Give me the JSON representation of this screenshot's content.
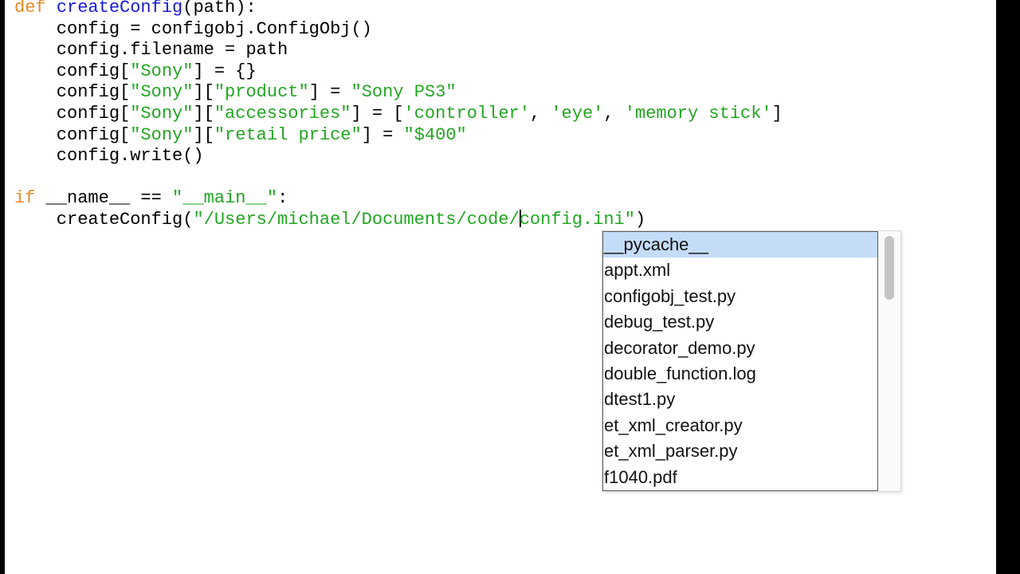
{
  "editor": {
    "lines": [
      [
        {
          "t": "def",
          "c": "kw"
        },
        {
          "t": " "
        },
        {
          "t": "createConfig",
          "c": "fn"
        },
        {
          "t": "(path):"
        }
      ],
      [
        {
          "t": "    config = configobj.ConfigObj()"
        }
      ],
      [
        {
          "t": "    config.filename = path"
        }
      ],
      [
        {
          "t": "    config["
        },
        {
          "t": "\"Sony\"",
          "c": "str"
        },
        {
          "t": "] = {}"
        }
      ],
      [
        {
          "t": "    config["
        },
        {
          "t": "\"Sony\"",
          "c": "str"
        },
        {
          "t": "]["
        },
        {
          "t": "\"product\"",
          "c": "str"
        },
        {
          "t": "] = "
        },
        {
          "t": "\"Sony PS3\"",
          "c": "str"
        }
      ],
      [
        {
          "t": "    config["
        },
        {
          "t": "\"Sony\"",
          "c": "str"
        },
        {
          "t": "]["
        },
        {
          "t": "\"accessories\"",
          "c": "str"
        },
        {
          "t": "] = ["
        },
        {
          "t": "'controller'",
          "c": "str"
        },
        {
          "t": ", "
        },
        {
          "t": "'eye'",
          "c": "str"
        },
        {
          "t": ", "
        },
        {
          "t": "'memory stick'",
          "c": "str"
        },
        {
          "t": "]"
        }
      ],
      [
        {
          "t": "    config["
        },
        {
          "t": "\"Sony\"",
          "c": "str"
        },
        {
          "t": "]["
        },
        {
          "t": "\"retail price\"",
          "c": "str"
        },
        {
          "t": "] = "
        },
        {
          "t": "\"$400\"",
          "c": "str"
        }
      ],
      [
        {
          "t": "    config.write()"
        }
      ],
      [
        {
          "t": ""
        }
      ],
      [
        {
          "t": "if",
          "c": "kw"
        },
        {
          "t": " __name__ == "
        },
        {
          "t": "\"__main__\"",
          "c": "str"
        },
        {
          "t": ":"
        }
      ],
      [
        {
          "t": "    createConfig("
        },
        {
          "t": "\"/Users/michael/Documents/code/",
          "c": "str"
        },
        {
          "t": "",
          "cursor": true
        },
        {
          "t": "config.ini\"",
          "c": "str"
        },
        {
          "t": ")"
        }
      ]
    ]
  },
  "autocomplete": {
    "items": [
      "__pycache__",
      "appt.xml",
      "configobj_test.py",
      "debug_test.py",
      "decorator_demo.py",
      "double_function.log",
      "dtest1.py",
      "et_xml_creator.py",
      "et_xml_parser.py",
      "f1040.pdf"
    ],
    "selected_index": 0
  },
  "colors": {
    "keyword": "#e98a25",
    "function_name": "#1a1ad8",
    "string": "#22a622",
    "selection": "#c5dcf9"
  }
}
